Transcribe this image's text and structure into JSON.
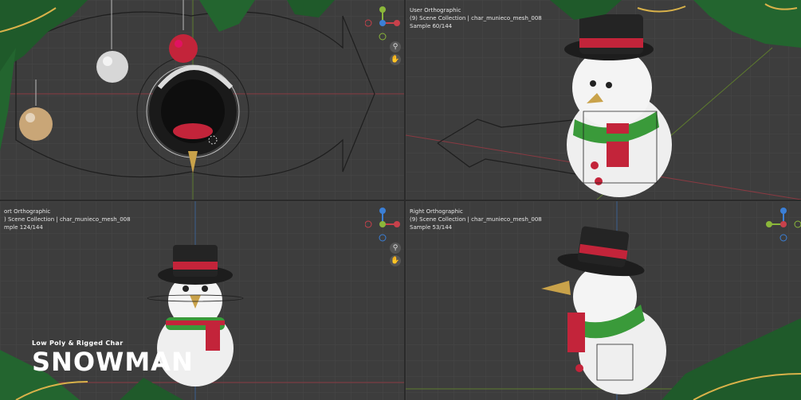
{
  "branding": {
    "subtitle": "Low Poly & Rigged Char",
    "title": "SNOWMAN"
  },
  "viewports": [
    {
      "id": "top-left",
      "view": "",
      "collection": "",
      "sample": ""
    },
    {
      "id": "top-right",
      "view": "User Orthographic",
      "collection": "(9) Scene Collection | char_munieco_mesh_008",
      "sample": "Sample 60/144"
    },
    {
      "id": "bottom-left",
      "view": "ort Orthographic",
      "collection": ") Scene Collection | char_munieco_mesh_008",
      "sample": "mple 124/144"
    },
    {
      "id": "bottom-right",
      "view": "Right Orthographic",
      "collection": "(9) Scene Collection | char_munieco_mesh_008",
      "sample": "Sample 53/144"
    }
  ],
  "icons": {
    "zoom": "magnifier-icon",
    "pan": "hand-icon",
    "gizmo": "axis-gizmo-icon"
  },
  "axis_labels": {
    "x": "X",
    "y": "Y",
    "z": "Z"
  },
  "colors": {
    "viewport_bg": "#3d3d3d",
    "x_axis": "#c8414b",
    "y_axis": "#8bb73a",
    "z_axis": "#3b7fd6",
    "accent_red": "#c3243a",
    "pine_green": "#1f5a2a"
  }
}
